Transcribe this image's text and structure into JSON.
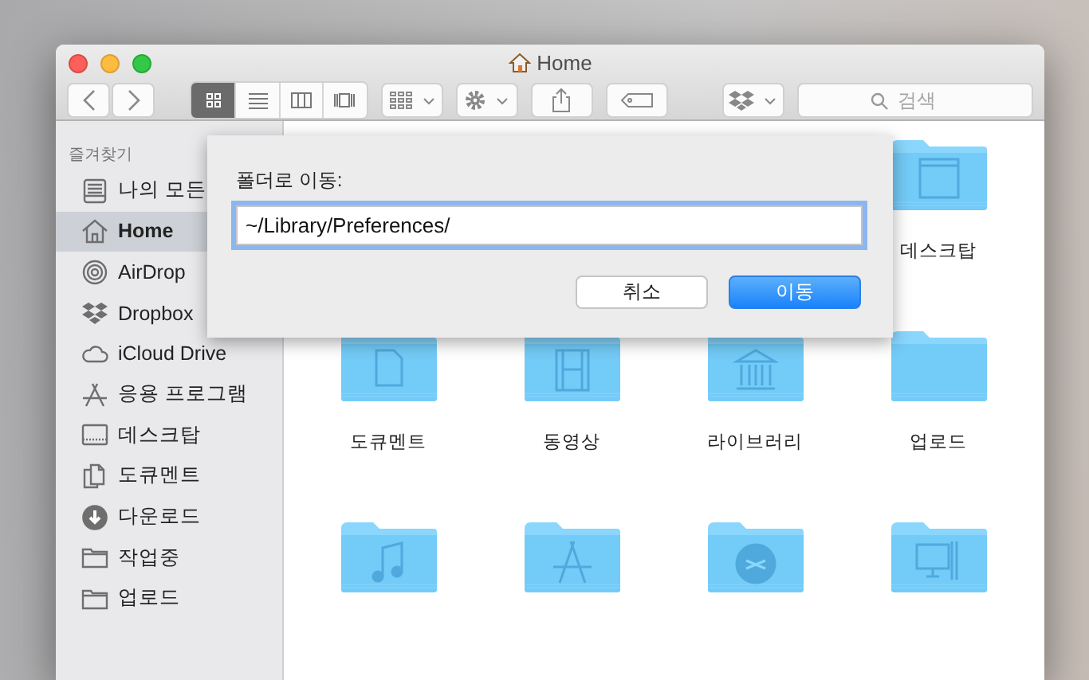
{
  "window": {
    "title": "Home"
  },
  "toolbar": {
    "view_modes": [
      {
        "selected": true
      },
      {
        "selected": false
      },
      {
        "selected": false
      },
      {
        "selected": false
      }
    ],
    "search": {
      "placeholder": "검색"
    }
  },
  "sidebar": {
    "heading": "즐겨찾기",
    "items": [
      {
        "label": "나의 모든",
        "selected": false
      },
      {
        "label": "Home",
        "selected": true
      },
      {
        "label": "AirDrop",
        "selected": false
      },
      {
        "label": "Dropbox",
        "selected": false
      },
      {
        "label": "iCloud Drive",
        "selected": false
      },
      {
        "label": "응용 프로그램",
        "selected": false
      },
      {
        "label": "데스크탑",
        "selected": false
      },
      {
        "label": "도큐멘트",
        "selected": false
      },
      {
        "label": "다운로드",
        "selected": false
      },
      {
        "label": "작업중",
        "selected": false
      },
      {
        "label": "업로드",
        "selected": false
      }
    ]
  },
  "folder_rows": [
    [
      {
        "label": "데스크탑"
      }
    ],
    [
      {
        "label": "도큐멘트"
      },
      {
        "label": "동영상"
      },
      {
        "label": "라이브러리"
      },
      {
        "label": "업로드"
      }
    ],
    [
      {},
      {},
      {},
      {}
    ]
  ],
  "dialog": {
    "label": "폴더로 이동:",
    "path": "~/Library/Preferences/",
    "buttons": [
      {
        "label": "취소",
        "kind": "cancel"
      },
      {
        "label": "이동",
        "kind": "default"
      }
    ]
  }
}
